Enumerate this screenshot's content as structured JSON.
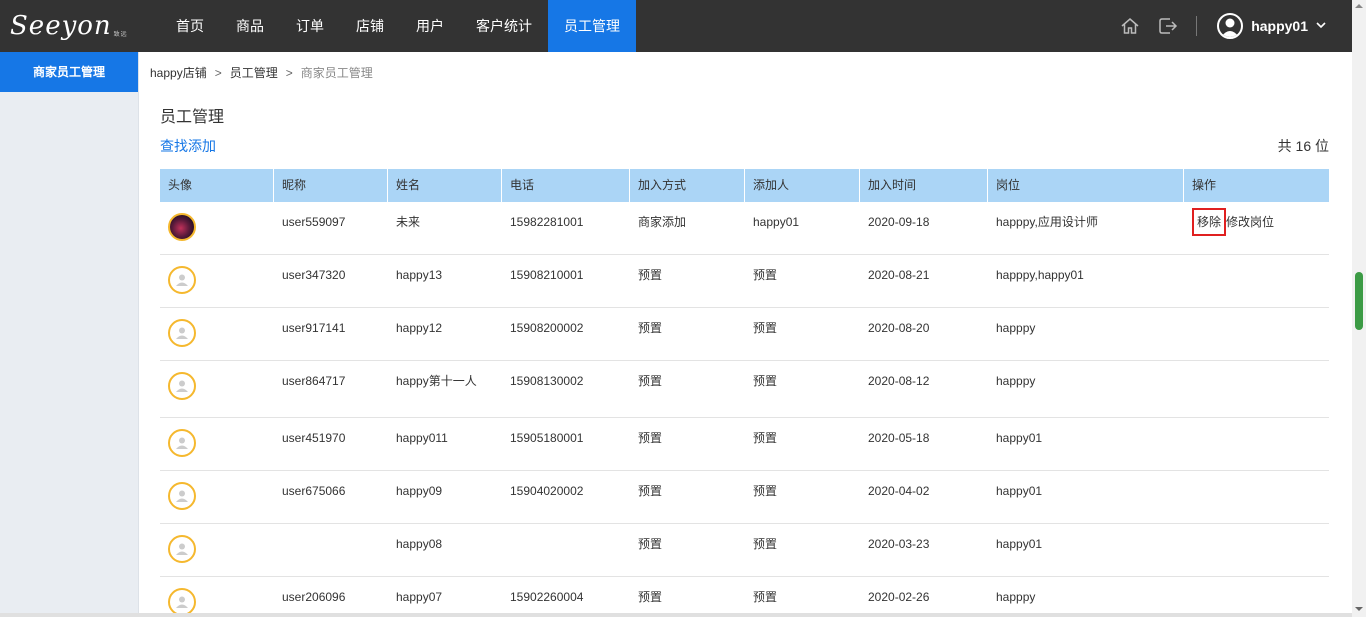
{
  "logo": {
    "text": "Seeyon",
    "sub": "致远"
  },
  "nav": {
    "items": [
      {
        "label": "首页"
      },
      {
        "label": "商品"
      },
      {
        "label": "订单"
      },
      {
        "label": "店铺"
      },
      {
        "label": "用户"
      },
      {
        "label": "客户统计"
      },
      {
        "label": "员工管理"
      }
    ],
    "active_index": 6
  },
  "header": {
    "username": "happy01",
    "icons": [
      "home-icon",
      "logout-icon"
    ]
  },
  "sidebar": {
    "items": [
      {
        "label": "商家员工管理"
      }
    ]
  },
  "breadcrumb": {
    "items": [
      "happy店铺",
      "员工管理",
      "商家员工管理"
    ]
  },
  "page": {
    "title": "员工管理",
    "add_link": "查找添加",
    "total": "共 16 位"
  },
  "table": {
    "columns": [
      "头像",
      "昵称",
      "姓名",
      "电话",
      "加入方式",
      "添加人",
      "加入时间",
      "岗位",
      "操作"
    ],
    "rows": [
      {
        "avatar": "photo",
        "nickname": "user559097",
        "name": "未来",
        "phone": "15982281001",
        "method": "商家添加",
        "adder": "happy01",
        "date": "2020-09-18",
        "post": "happpy,应用设计师",
        "ops": [
          "移除",
          "修改岗位"
        ]
      },
      {
        "avatar": "default",
        "nickname": "user347320",
        "name": "happy13",
        "phone": "15908210001",
        "method": "预置",
        "adder": "预置",
        "date": "2020-08-21",
        "post": "happpy,happy01",
        "ops": []
      },
      {
        "avatar": "default",
        "nickname": "user917141",
        "name": "happy12",
        "phone": "15908200002",
        "method": "预置",
        "adder": "预置",
        "date": "2020-08-20",
        "post": "happpy",
        "ops": []
      },
      {
        "avatar": "default",
        "nickname": "user864717",
        "name": "happy第十一人",
        "phone": "15908130002",
        "method": "预置",
        "adder": "预置",
        "date": "2020-08-12",
        "post": "happpy",
        "ops": []
      },
      {
        "avatar": "default",
        "nickname": "user451970",
        "name": "happy011",
        "phone": "15905180001",
        "method": "预置",
        "adder": "预置",
        "date": "2020-05-18",
        "post": "happy01",
        "ops": []
      },
      {
        "avatar": "default",
        "nickname": "user675066",
        "name": "happy09",
        "phone": "15904020002",
        "method": "预置",
        "adder": "预置",
        "date": "2020-04-02",
        "post": "happy01",
        "ops": []
      },
      {
        "avatar": "default",
        "nickname": "",
        "name": "happy08",
        "phone": "",
        "method": "预置",
        "adder": "预置",
        "date": "2020-03-23",
        "post": "happy01",
        "ops": []
      },
      {
        "avatar": "default",
        "nickname": "user206096",
        "name": "happy07",
        "phone": "15902260004",
        "method": "预置",
        "adder": "预置",
        "date": "2020-02-26",
        "post": "happpy",
        "ops": []
      }
    ]
  },
  "colors": {
    "topbar": "#333333",
    "accent": "#1677e6",
    "table_header": "#abd5f6",
    "avatar_ring": "#f5b82e",
    "highlight": "#e02020"
  }
}
